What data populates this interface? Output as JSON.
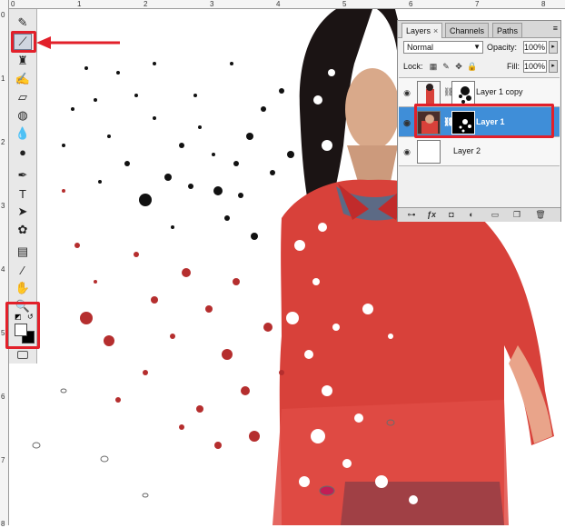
{
  "rulers": {
    "top_labels": [
      "0",
      "1",
      "2",
      "3",
      "4",
      "5",
      "6",
      "7",
      "8"
    ],
    "left_labels": [
      "0",
      "1",
      "2",
      "3",
      "4",
      "5",
      "6",
      "7",
      "8"
    ]
  },
  "toolbox": {
    "tools": [
      {
        "name": "pencil-tool-icon",
        "glyph": "✎"
      },
      {
        "name": "brush-tool-icon",
        "glyph": "⟋",
        "active": true
      },
      {
        "name": "clone-stamp-tool-icon",
        "glyph": "♜"
      },
      {
        "name": "history-brush-tool-icon",
        "glyph": "✍"
      },
      {
        "name": "eraser-tool-icon",
        "glyph": "▱"
      },
      {
        "name": "paint-bucket-tool-icon",
        "glyph": "◍"
      },
      {
        "name": "blur-tool-icon",
        "glyph": "💧"
      },
      {
        "name": "dodge-tool-icon",
        "glyph": "●"
      },
      {
        "name": "pen-tool-icon",
        "glyph": "✒"
      },
      {
        "name": "type-tool-icon",
        "glyph": "T"
      },
      {
        "name": "path-selection-tool-icon",
        "glyph": "➤"
      },
      {
        "name": "custom-shape-tool-icon",
        "glyph": "✿"
      },
      {
        "name": "notes-tool-icon",
        "glyph": "▤"
      },
      {
        "name": "eyedropper-tool-icon",
        "glyph": "⁄"
      },
      {
        "name": "hand-tool-icon",
        "glyph": "✋"
      },
      {
        "name": "zoom-tool-icon",
        "glyph": "🔍"
      }
    ]
  },
  "colors": {
    "highlight": "#e2202a",
    "selection_blue": "#3f8ed8",
    "dress_red": "#d8413a",
    "foreground": "#000000",
    "background": "#ffffff"
  },
  "layers_panel": {
    "tabs": [
      {
        "label": "Layers",
        "close": "×",
        "active": true
      },
      {
        "label": "Channels",
        "active": false
      },
      {
        "label": "Paths",
        "active": false
      }
    ],
    "blend_mode": "Normal",
    "opacity_label": "Opacity:",
    "opacity_value": "100%",
    "lock_label": "Lock:",
    "fill_label": "Fill:",
    "fill_value": "100%",
    "layers": [
      {
        "name": "Layer 1 copy",
        "selected": false,
        "has_mask": true
      },
      {
        "name": "Layer 1",
        "selected": true,
        "has_mask": true
      },
      {
        "name": "Layer 2",
        "selected": false,
        "has_mask": false
      }
    ],
    "bottom_icons": [
      "link-layers-icon",
      "fx-icon",
      "add-mask-icon",
      "adjustment-layer-icon",
      "new-group-icon",
      "new-layer-icon",
      "delete-layer-icon"
    ]
  }
}
